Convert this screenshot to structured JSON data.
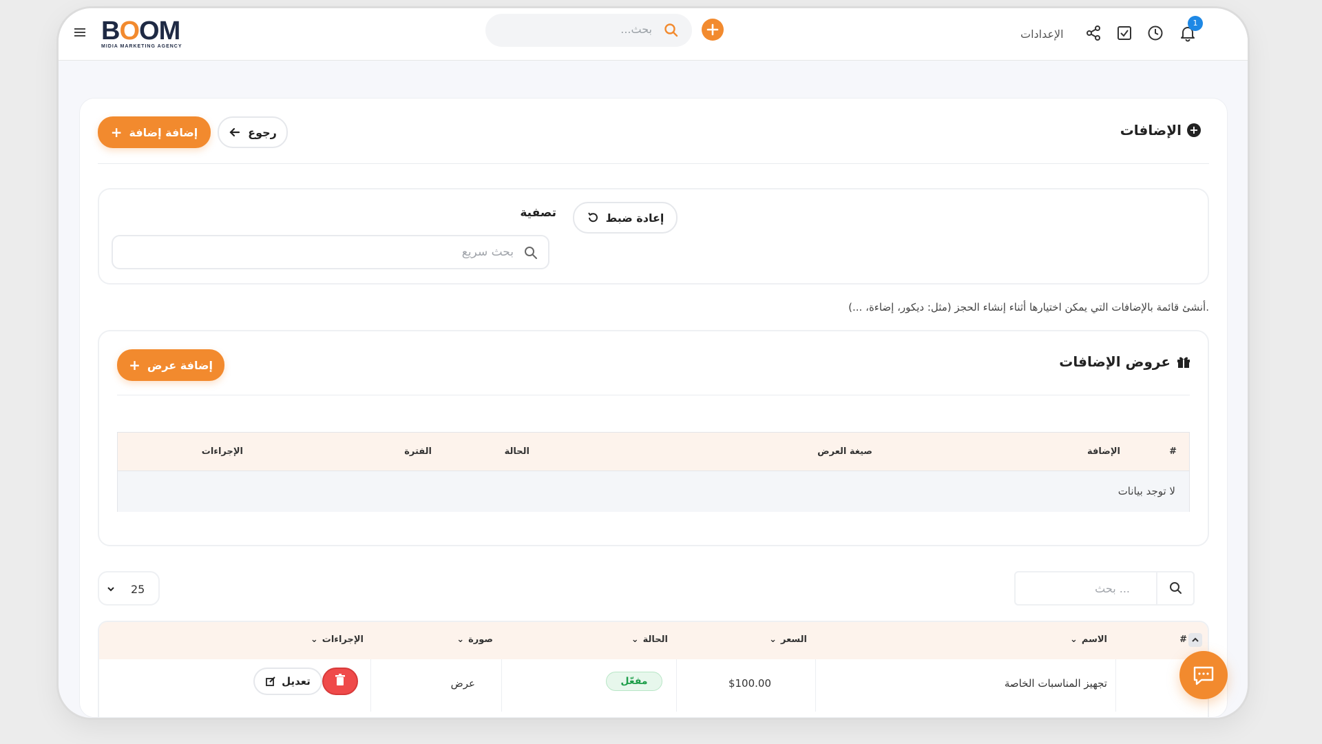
{
  "header": {
    "logo_text": "BOOM",
    "logo_tagline": "MIDIA MARKETING AGENCY",
    "search_placeholder": "...بحث",
    "settings_label": "الإعدادات",
    "notification_count": "1"
  },
  "page": {
    "title": "الإضافات",
    "add_button": "إضافة إضافة",
    "back_button": "رجوع"
  },
  "filter": {
    "label": "تصفية",
    "reset_button": "إعادة ضبط",
    "quick_search_placeholder": "بحث سريع"
  },
  "description": "أنشئ قائمة بالإضافات التي يمكن اختيارها أثناء إنشاء الحجز (مثل: ديكور، إضاءة، ...).",
  "offers": {
    "title": "عروض الإضافات",
    "add_button": "إضافة عرض",
    "columns": [
      "#",
      "الإضافة",
      "صيغة العرض",
      "الحالة",
      "الفترة",
      "الإجراءات"
    ],
    "empty_text": "لا توجد بيانات"
  },
  "table": {
    "page_size": "25",
    "search_placeholder": "بحث ...",
    "columns": [
      "#",
      "الاسم",
      "السعر",
      "الحالة",
      "صورة",
      "الإجراءات"
    ],
    "rows": [
      {
        "name": "تجهيز المناسبات الخاصة",
        "price": "$100.00",
        "status": "مفعّل",
        "image": "عرض",
        "edit_label": "تعديل"
      }
    ]
  },
  "colors": {
    "accent": "#f28a2e",
    "danger": "#ef4a4a",
    "success": "#1e9e4a",
    "header_bg": "#fdf3ec"
  },
  "icons": [
    "hamburger-icon",
    "search-icon",
    "plus-icon",
    "share-icon",
    "checkbox-icon",
    "clock-icon",
    "bell-icon",
    "arrow-left-icon",
    "reset-icon",
    "gift-icon",
    "chevron-down-icon",
    "trash-icon",
    "edit-icon",
    "chat-icon"
  ]
}
